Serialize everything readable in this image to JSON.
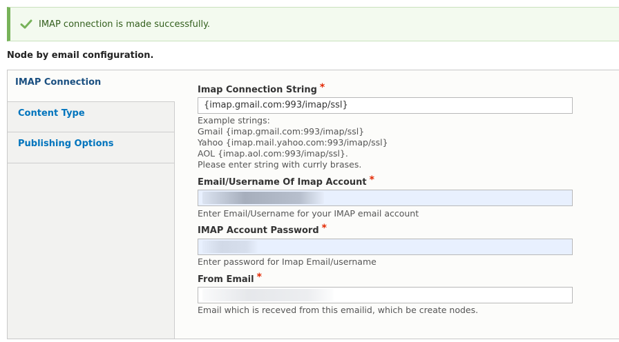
{
  "status": {
    "icon": "checkmark-icon",
    "color": "#77b259",
    "message": "IMAP connection is made successfully."
  },
  "page_title": "Node by email configuration.",
  "tabs": [
    {
      "label": "IMAP Connection",
      "active": true
    },
    {
      "label": "Content Type",
      "active": false
    },
    {
      "label": "Publishing Options",
      "active": false
    }
  ],
  "fields": {
    "connection_string": {
      "label": "Imap Connection String",
      "required_mark": "*",
      "value": "{imap.gmail.com:993/imap/ssl}",
      "description": [
        "Example strings:",
        "Gmail {imap.gmail.com:993/imap/ssl}",
        "Yahoo {imap.mail.yahoo.com:993/imap/ssl}",
        "AOL {imap.aol.com:993/imap/ssl}.",
        "Please enter string with currly brases."
      ]
    },
    "username": {
      "label": "Email/Username Of Imap Account",
      "required_mark": "*",
      "description": "Enter Email/Username for your IMAP email account"
    },
    "password": {
      "label": "IMAP Account Password",
      "required_mark": "*",
      "description": "Enter password for Imap Email/username"
    },
    "from_email": {
      "label": "From Email",
      "required_mark": "*",
      "description": "Email which is receved from this emailid, which be create nodes."
    }
  },
  "colors": {
    "required": "#e32700",
    "link": "#0074bd",
    "autofill": "#e8f0fe"
  }
}
